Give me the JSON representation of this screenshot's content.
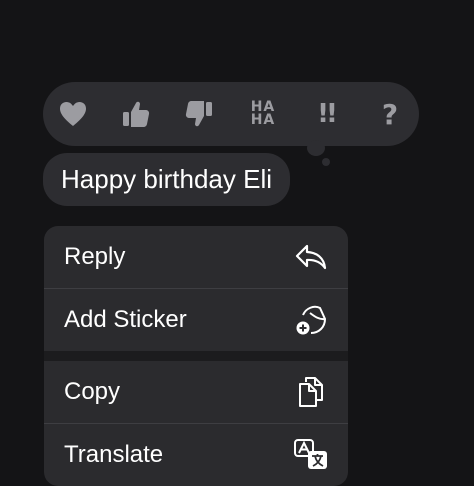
{
  "tapbacks": [
    {
      "icon": "heart-icon"
    },
    {
      "icon": "thumbs-up-icon"
    },
    {
      "icon": "thumbs-down-icon"
    },
    {
      "icon": "haha-icon",
      "line1": "HA",
      "line2": "HA"
    },
    {
      "icon": "exclamation-icon",
      "text": "!!"
    },
    {
      "icon": "question-icon",
      "text": "?"
    }
  ],
  "message": {
    "text": "Happy birthday Eli"
  },
  "menu": {
    "items": [
      {
        "label": "Reply",
        "icon": "reply-arrow-icon"
      },
      {
        "label": "Add Sticker",
        "icon": "sticker-add-icon"
      },
      {
        "label": "Copy",
        "icon": "copy-icon"
      },
      {
        "label": "Translate",
        "icon": "translate-icon"
      }
    ]
  },
  "colors": {
    "background": "#141416",
    "bubble": "#2d2d31",
    "icon": "#9c9ca1",
    "text": "#ffffff"
  }
}
